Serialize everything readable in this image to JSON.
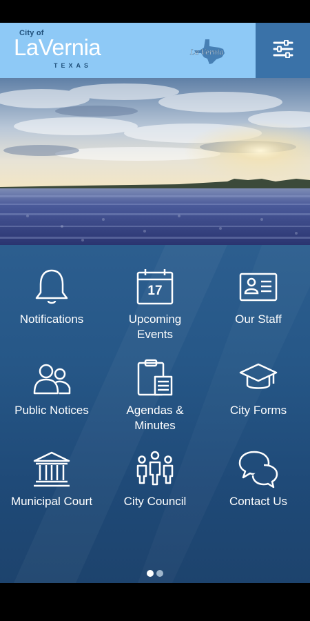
{
  "header": {
    "logo_small": "City of",
    "logo_name": "LaVernia",
    "logo_state": "TEXAS",
    "badge_text": "La Vernia",
    "menu_icon": "sliders-icon",
    "background": "#8ec9f6",
    "menu_background": "#3a72a8"
  },
  "hero": {
    "description_icon": "bluebonnet-field-photo"
  },
  "tiles": [
    {
      "label": "Notifications",
      "icon": "bell-icon"
    },
    {
      "label": "Upcoming Events",
      "icon": "calendar-icon",
      "calendar_day": "17"
    },
    {
      "label": "Our Staff",
      "icon": "id-card-icon"
    },
    {
      "label": "Public Notices",
      "icon": "people-icon"
    },
    {
      "label": "Agendas & Minutes",
      "icon": "clipboard-icon"
    },
    {
      "label": "City Forms",
      "icon": "graduation-cap-icon"
    },
    {
      "label": "Municipal Court",
      "icon": "courthouse-icon"
    },
    {
      "label": "City Council",
      "icon": "council-icon"
    },
    {
      "label": "Contact Us",
      "icon": "chat-bubbles-icon"
    }
  ],
  "pager": {
    "pages": 2,
    "current": 1
  }
}
